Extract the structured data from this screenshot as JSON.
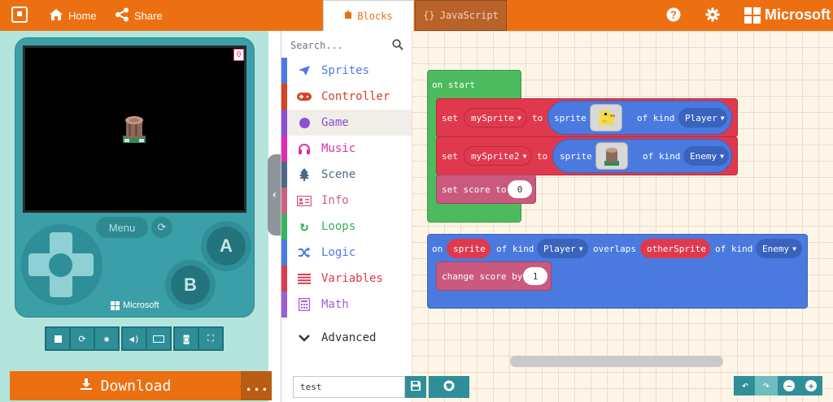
{
  "topbar": {
    "home_label": "Home",
    "share_label": "Share",
    "tabs": {
      "blocks": "Blocks",
      "javascript": "JavaScript"
    },
    "brand": "Microsoft"
  },
  "simulator": {
    "score": "0",
    "menu_label": "Menu",
    "brand": "Microsoft",
    "button_a": "A",
    "button_b": "B"
  },
  "download": {
    "label": "Download",
    "more": "..."
  },
  "toolbox": {
    "search_placeholder": "Search...",
    "categories": [
      {
        "label": "Sprites",
        "color": "#4b7be5"
      },
      {
        "label": "Controller",
        "color": "#d54322"
      },
      {
        "label": "Game",
        "color": "#8b4fd1"
      },
      {
        "label": "Music",
        "color": "#e12bb1"
      },
      {
        "label": "Scene",
        "color": "#4b6a84"
      },
      {
        "label": "Info",
        "color": "#cf5e84"
      },
      {
        "label": "Loops",
        "color": "#35b35d"
      },
      {
        "label": "Logic",
        "color": "#4b7be5"
      },
      {
        "label": "Variables",
        "color": "#d93e4e"
      },
      {
        "label": "Math",
        "color": "#9b60d8"
      }
    ],
    "advanced": "Advanced"
  },
  "workspace": {
    "on_start": {
      "label": "on start",
      "set1": {
        "set": "set",
        "var": "mySprite",
        "to": "to",
        "sprite": "sprite",
        "of_kind": "of kind",
        "kind": "Player"
      },
      "set2": {
        "set": "set",
        "var": "mySprite2",
        "to": "to",
        "sprite": "sprite",
        "of_kind": "of kind",
        "kind": "Enemy"
      },
      "score": {
        "label": "set score to",
        "value": "0"
      }
    },
    "overlap": {
      "on": "on",
      "sprite": "sprite",
      "of_kind1": "of kind",
      "kind1": "Player",
      "overlaps": "overlaps",
      "other": "otherSprite",
      "of_kind2": "of kind",
      "kind2": "Enemy",
      "change": {
        "label": "change score by",
        "value": "1"
      }
    }
  },
  "project": {
    "name": "test"
  },
  "colors": {
    "accent": "#ec7012",
    "loops": "#4cbb5d",
    "sprites": "#e0394e",
    "logic": "#4a7ae0",
    "info": "#c9597f"
  }
}
